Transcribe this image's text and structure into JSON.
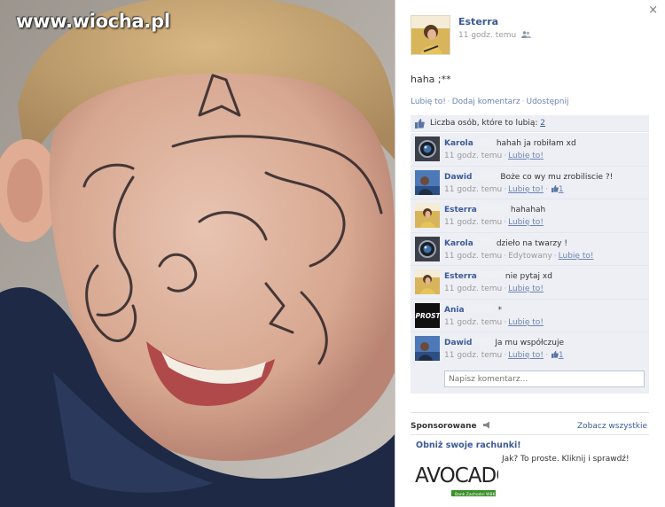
{
  "watermark": "www.wiocha.pl",
  "panel": {
    "close_glyph": "×",
    "author": {
      "name": "Esterra",
      "time": "11 godz. temu",
      "privacy_icon": "people-icon"
    },
    "status_text": "haha ;**",
    "actions": {
      "like": "Lubię to!",
      "comment": "Dodaj komentarz",
      "share": "Udostępnij",
      "separator": "·"
    },
    "likes": {
      "label": "Liczba osób, które to lubią:",
      "count": "2"
    },
    "comments": [
      {
        "name": "Karola",
        "text": "hahah ja robiłam xd",
        "time": "11 godz. temu",
        "edited": "",
        "like": "Lubię to!",
        "likes": "",
        "avatar": "camera"
      },
      {
        "name": "Dawid",
        "text": "Boże co wy mu zrobiliscie ?!",
        "time": "11 godz. temu",
        "edited": "",
        "like": "Lubię to!",
        "likes": "1",
        "avatar": "blue"
      },
      {
        "name": "Esterra",
        "text": "hahahah",
        "time": "11 godz. temu",
        "edited": "",
        "like": "Lubię to!",
        "likes": "",
        "avatar": "gold"
      },
      {
        "name": "Karola",
        "text": "dzieło na twarzy !",
        "time": "11 godz. temu",
        "edited": "Edytowany",
        "like": "Lubię to!",
        "likes": "",
        "avatar": "camera"
      },
      {
        "name": "Esterra",
        "text": "nie pytaj xd",
        "time": "11 godz. temu",
        "edited": "",
        "like": "Lubię to!",
        "likes": "",
        "avatar": "gold"
      },
      {
        "name": "Ania",
        "text": "*",
        "time": "11 godz. temu",
        "edited": "",
        "like": "Lubię to!",
        "likes": "",
        "avatar": "prosto"
      },
      {
        "name": "Dawid",
        "text": "Ja mu współczuje",
        "time": "11 godz. temu",
        "edited": "",
        "like": "Lubię to!",
        "likes": "1",
        "avatar": "blue"
      }
    ],
    "write_placeholder": "Napisz komentarz...",
    "sponsored": {
      "title": "Sponsorowane",
      "see_all": "Zobacz wszystkie",
      "ad_title": "Obniż swoje rachunki!",
      "ad_text": "Jak? To proste. Kliknij i sprawdź!",
      "ad_logo_text": "AVOCADO",
      "ad_logo_tagline": "Bank Zachodni WBK"
    }
  },
  "colors": {
    "link": "#3b5998",
    "link_light": "#6d84b4",
    "comment_bg": "#edeff4",
    "ad_green": "#3c8f2a"
  },
  "avatar_prosto_text": "PROSTO"
}
